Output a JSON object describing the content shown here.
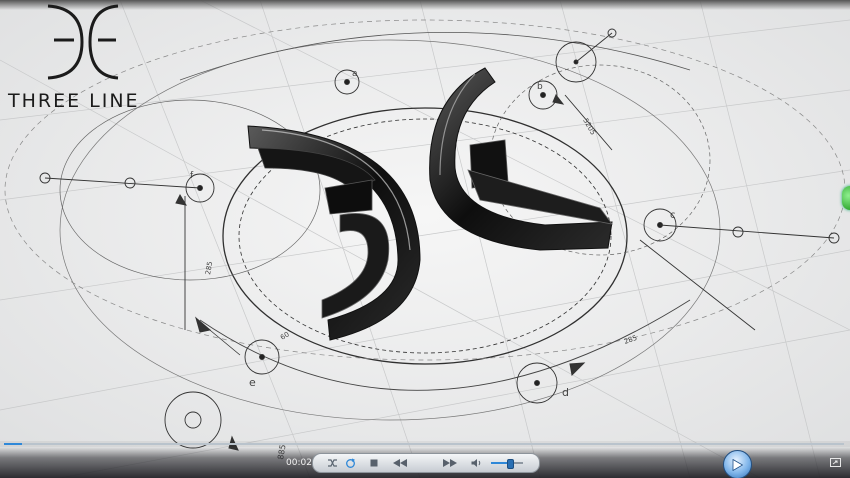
{
  "video": {
    "logo_text": "THREE LINE",
    "labels": {
      "a": "a",
      "b": "b",
      "c": "c",
      "d": "d",
      "e": "e",
      "f": "f",
      "dim_top": "5205",
      "dim_left": "285",
      "dim_mid_left": "60",
      "dim_right": "285",
      "dim_bottom": "885"
    }
  },
  "player": {
    "current_time": "00:02",
    "seek_progress": 0.02,
    "volume_level": 0.6,
    "accent_color": "#2f88d8",
    "buttons": {
      "shuffle": "shuffle-icon",
      "repeat": "repeat-icon",
      "stop": "stop-icon",
      "previous": "rewind-icon",
      "play": "play-icon",
      "next": "fast-forward-icon",
      "mute": "speaker-icon",
      "fullscreen": "fullscreen-icon"
    }
  }
}
